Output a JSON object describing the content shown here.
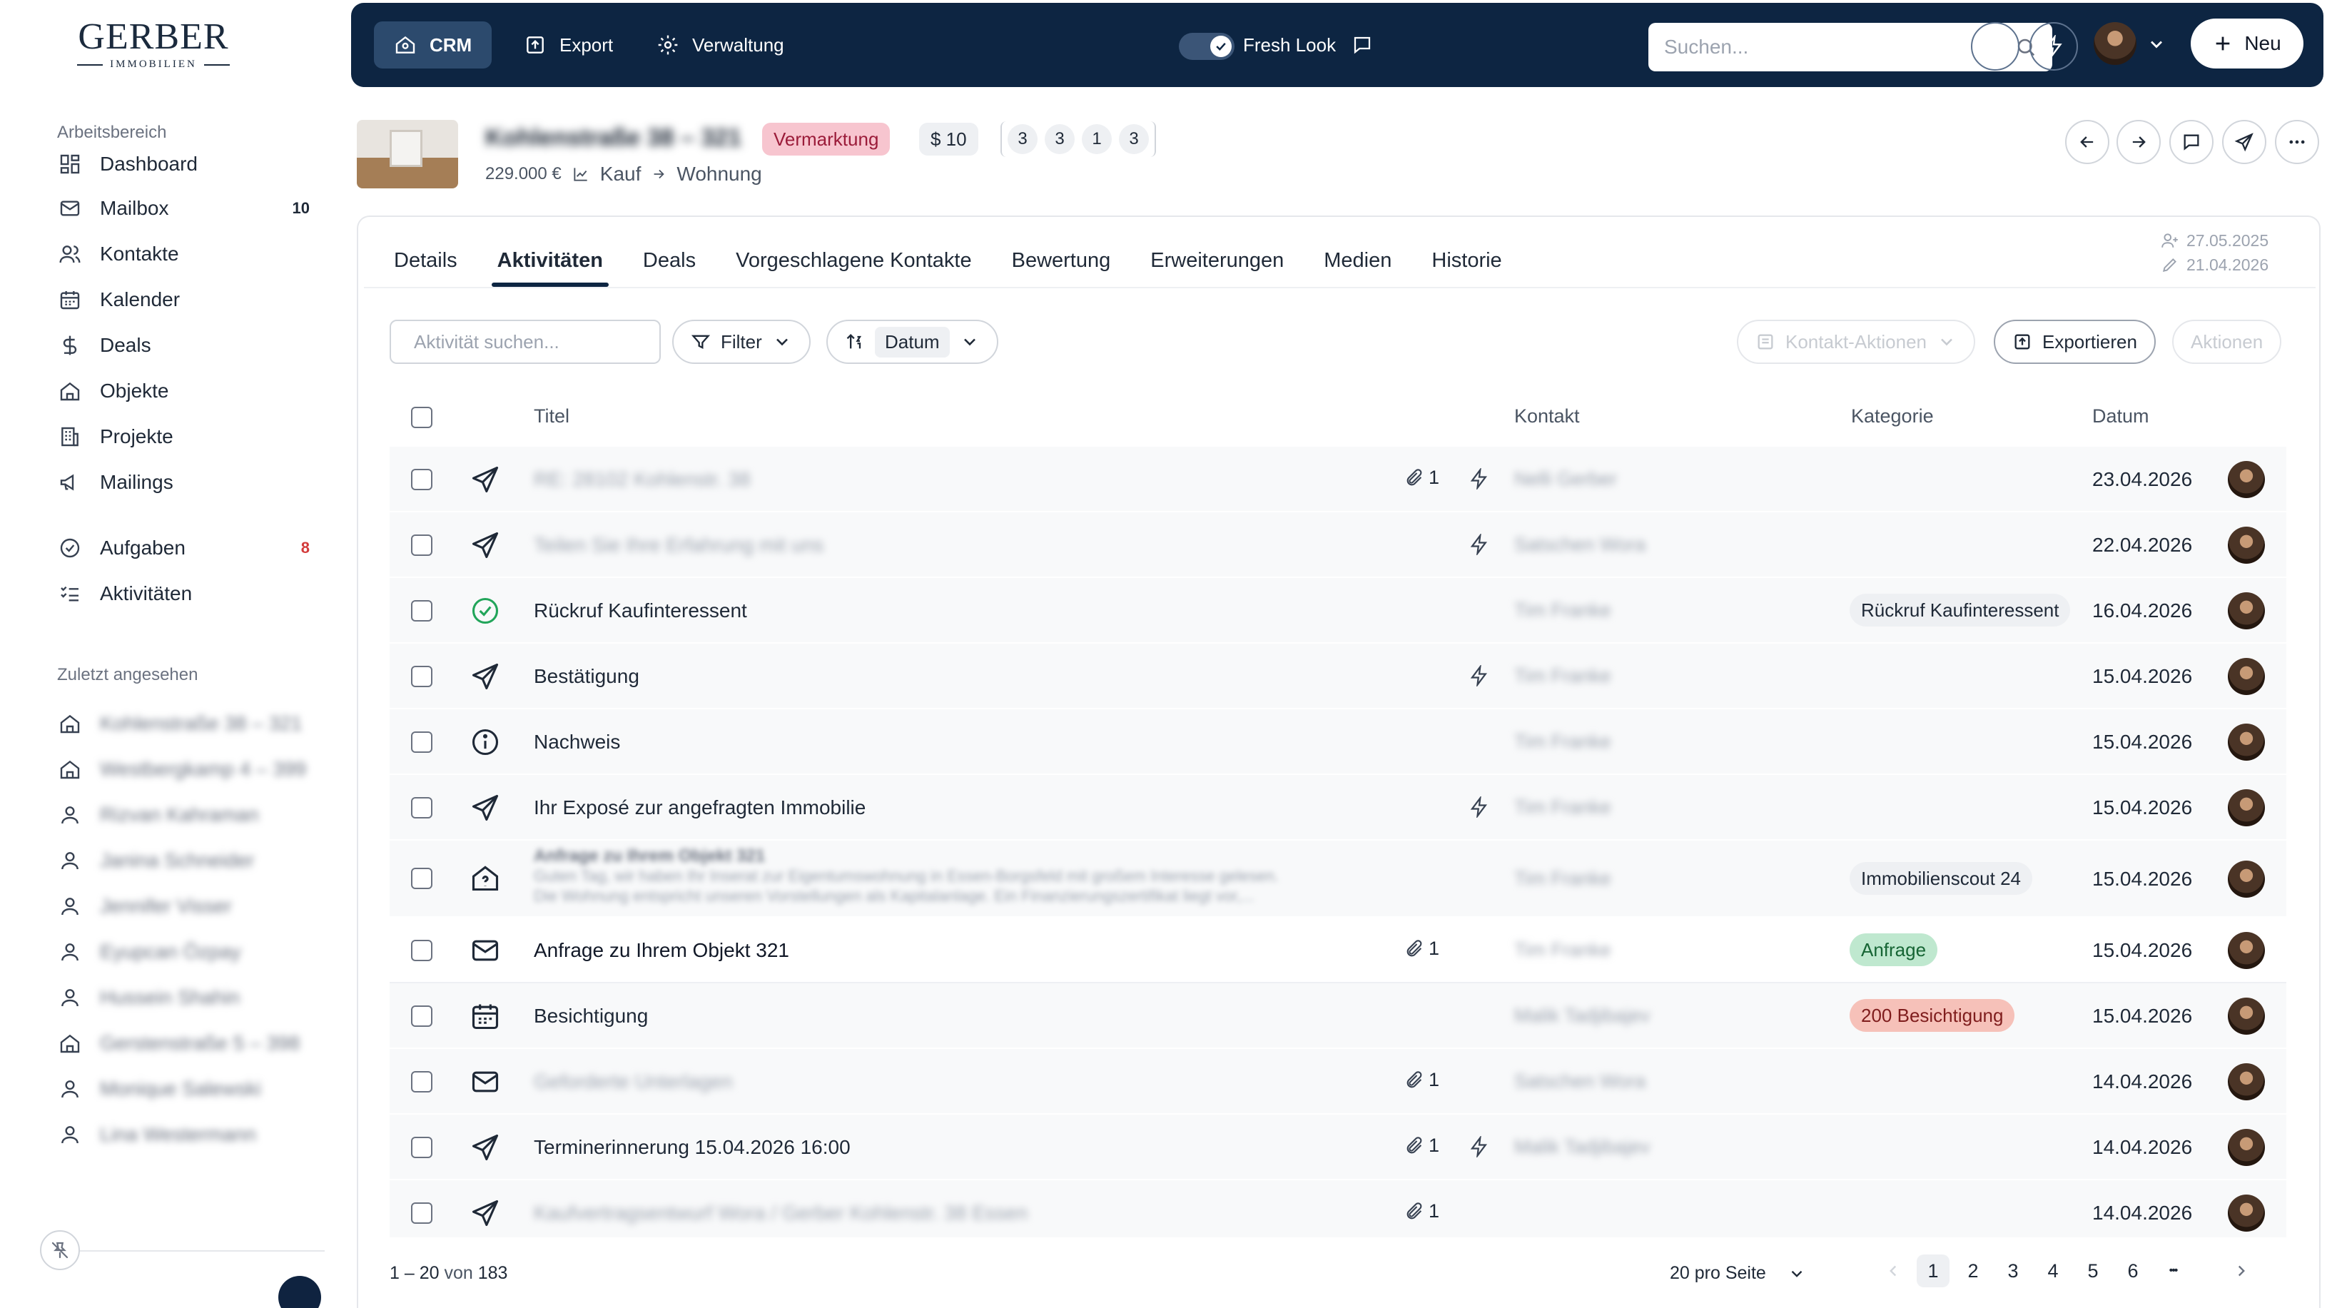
{
  "brand": {
    "name": "GERBER",
    "sub": "IMMOBILIEN"
  },
  "sidebar": {
    "workspace_label": "Arbeitsbereich",
    "items": [
      {
        "label": "Dashboard",
        "icon": "dashboard-icon",
        "badge": ""
      },
      {
        "label": "Mailbox",
        "icon": "mail-icon",
        "badge": "10"
      },
      {
        "label": "Kontakte",
        "icon": "users-icon",
        "badge": ""
      },
      {
        "label": "Kalender",
        "icon": "calendar-icon",
        "badge": ""
      },
      {
        "label": "Deals",
        "icon": "dollar-icon",
        "badge": ""
      },
      {
        "label": "Objekte",
        "icon": "home-icon",
        "badge": ""
      },
      {
        "label": "Projekte",
        "icon": "building-icon",
        "badge": ""
      },
      {
        "label": "Mailings",
        "icon": "megaphone-icon",
        "badge": ""
      },
      {
        "label": "Aufgaben",
        "icon": "check-circle-icon",
        "badge": "8"
      },
      {
        "label": "Aktivitäten",
        "icon": "list-check-icon",
        "badge": ""
      }
    ],
    "recent_label": "Zuletzt angesehen",
    "recent": [
      {
        "label": "Kohlenstraße 38 – 321",
        "icon": "home-icon"
      },
      {
        "label": "Westbergkamp 4 – 399",
        "icon": "home-icon"
      },
      {
        "label": "Rizvan Kahraman",
        "icon": "user-icon"
      },
      {
        "label": "Janina Schneider",
        "icon": "user-icon"
      },
      {
        "label": "Jennifer Visser",
        "icon": "user-icon"
      },
      {
        "label": "Eyupcan Özpay",
        "icon": "user-icon"
      },
      {
        "label": "Hussein Shahin",
        "icon": "user-icon"
      },
      {
        "label": "Gerstenstraße 5 – 398",
        "icon": "home-icon"
      },
      {
        "label": "Monique Salewski",
        "icon": "user-icon"
      },
      {
        "label": "Lina Westermann",
        "icon": "user-icon"
      }
    ]
  },
  "topbar": {
    "crm": "CRM",
    "export": "Export",
    "admin": "Verwaltung",
    "fresh_look": "Fresh Look",
    "search_placeholder": "Suchen...",
    "new": "Neu"
  },
  "property": {
    "title": "Kohlenstraße 38 – 321",
    "status": "Vermarktung",
    "deals": "$ 10",
    "counts": [
      "3",
      "3",
      "1",
      "3"
    ],
    "price": "229.000 €",
    "kind": "Kauf",
    "type": "Wohnung"
  },
  "tabs": [
    "Details",
    "Aktivitäten",
    "Deals",
    "Vorgeschlagene Kontakte",
    "Bewertung",
    "Erweiterungen",
    "Medien",
    "Historie"
  ],
  "active_tab": "Aktivitäten",
  "dates": {
    "created": "27.05.2025",
    "edited": "21.04.2026"
  },
  "toolbar": {
    "search_placeholder": "Aktivität suchen...",
    "filter": "Filter",
    "sort": "Datum",
    "contact_actions": "Kontakt-Aktionen",
    "export": "Exportieren",
    "actions": "Aktionen"
  },
  "table": {
    "headers": {
      "title": "Titel",
      "contact": "Kontakt",
      "category": "Kategorie",
      "date": "Datum"
    },
    "rows": [
      {
        "icon": "send-icon",
        "title": "RE: 28102 Kohlenstr. 38",
        "blurred": true,
        "attachments": "1",
        "bolt": true,
        "contact": "Nelli Gerber",
        "category": "",
        "cat_style": "",
        "date": "23.04.2026"
      },
      {
        "icon": "send-icon",
        "title": "Teilen Sie Ihre Erfahrung mit uns",
        "blurred": true,
        "attachments": "",
        "bolt": true,
        "contact": "Satschen Wora",
        "category": "",
        "cat_style": "",
        "date": "22.04.2026"
      },
      {
        "icon": "check-circle-icon",
        "title": "Rückruf Kaufinteressent",
        "blurred": false,
        "attachments": "",
        "bolt": false,
        "contact": "Tim Franke",
        "category": "Rückruf Kaufinteressent",
        "cat_style": "gray",
        "date": "16.04.2026"
      },
      {
        "icon": "send-icon",
        "title": "Bestätigung",
        "blurred": false,
        "attachments": "",
        "bolt": true,
        "contact": "Tim Franke",
        "category": "",
        "cat_style": "",
        "date": "15.04.2026"
      },
      {
        "icon": "info-icon",
        "title": "Nachweis",
        "blurred": false,
        "attachments": "",
        "bolt": false,
        "contact": "Tim Franke",
        "category": "",
        "cat_style": "",
        "date": "15.04.2026"
      },
      {
        "icon": "send-icon",
        "title": "Ihr Exposé zur angefragten Immobilie",
        "blurred": false,
        "attachments": "",
        "bolt": true,
        "contact": "Tim Franke",
        "category": "",
        "cat_style": "",
        "date": "15.04.2026"
      },
      {
        "icon": "home-question-icon",
        "title": "Anfrage zu Ihrem Objekt 321",
        "preview1": "Guten Tag, wir haben Ihr Inserat zur Eigentumswohnung in Essen-Borgsfeld mit großem Interesse gelesen.",
        "preview2": "Die Wohnung entspricht unseren Vorstellungen als Kapitalanlage. Ein Finanzierungszertifikat liegt vor,...",
        "blurred": true,
        "attachments": "",
        "bolt": false,
        "contact": "Tim Franke",
        "category": "Immobilienscout 24",
        "cat_style": "gray",
        "date": "15.04.2026"
      },
      {
        "icon": "mail-icon",
        "title": "Anfrage zu Ihrem Objekt 321",
        "blurred": false,
        "attachments": "1",
        "bolt": false,
        "contact": "Tim Franke",
        "category": "Anfrage",
        "cat_style": "green",
        "date": "15.04.2026"
      },
      {
        "icon": "calendar-icon",
        "title": "Besichtigung",
        "blurred": false,
        "attachments": "",
        "bolt": false,
        "contact": "Malik Tadjibajev",
        "category": "200 Besichtigung",
        "cat_style": "red",
        "date": "15.04.2026"
      },
      {
        "icon": "mail-icon",
        "title": "Geforderte Unterlagen",
        "blurred": true,
        "attachments": "1",
        "bolt": false,
        "contact": "Satschen Wora",
        "category": "",
        "cat_style": "",
        "date": "14.04.2026"
      },
      {
        "icon": "send-icon",
        "title": "Terminerinnerung 15.04.2026 16:00",
        "blurred": false,
        "attachments": "1",
        "bolt": true,
        "contact": "Malik Tadjibajev",
        "category": "",
        "cat_style": "",
        "date": "14.04.2026"
      },
      {
        "icon": "send-icon",
        "title": "Kaufvertragsentwurf Wora / Gerber Kohlenstr. 38 Essen",
        "blurred": true,
        "attachments": "1",
        "bolt": false,
        "contact": "",
        "category": "",
        "cat_style": "",
        "date": "14.04.2026"
      }
    ]
  },
  "footer": {
    "range": "1 – 20",
    "of": "von",
    "total": "183",
    "per_page": "20 pro Seite",
    "pages": [
      "1",
      "2",
      "3",
      "4",
      "5",
      "6"
    ],
    "ellipsis": "•••",
    "current_page": "1"
  },
  "colors": {
    "topbar": "#0d2542",
    "accent_dark": "#0d2542",
    "badge_red": "#d33b3b",
    "tag_pink": "#f7c5cf",
    "cat_green": "#bfe8cf",
    "cat_red": "#f6c1b9"
  }
}
